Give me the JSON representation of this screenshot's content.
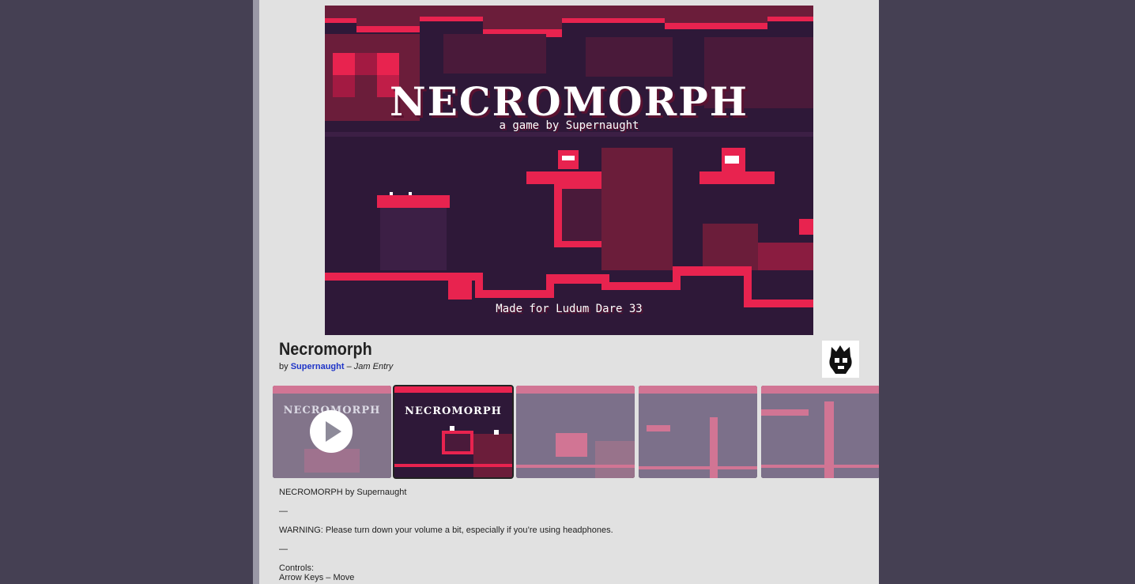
{
  "hero": {
    "title": "NECROMORPH",
    "subtitle": "a game by Supernaught",
    "footer": "Made for Ludum Dare 33"
  },
  "game": {
    "title": "Necromorph",
    "by_prefix": "by",
    "author": "Supernaught",
    "separator": "–",
    "entry_type": "Jam Entry"
  },
  "thumbnails": [
    {
      "kind": "video",
      "label": "NECROMORPH",
      "state": "dim"
    },
    {
      "kind": "image",
      "label": "NECROMORPH",
      "state": "active"
    },
    {
      "kind": "image",
      "label": "",
      "state": "dim"
    },
    {
      "kind": "image",
      "label": "",
      "state": "dim"
    },
    {
      "kind": "image",
      "label": "",
      "state": "dim"
    }
  ],
  "description": {
    "line1": "NECROMORPH by Supernaught",
    "rule1": "—",
    "warning": "WARNING: Please turn down your volume a bit, especially if you’re using headphones.",
    "rule2": "—",
    "controls_heading": "Controls:",
    "controls_line1": "Arrow Keys – Move"
  },
  "colors": {
    "background": "#454053",
    "panel": "#e1e1e1",
    "link": "#1f35c8",
    "game_crimson": "#e8234f",
    "game_dark": "#2a1533"
  },
  "icons": {
    "play": "play-icon",
    "avatar": "skull-avatar"
  }
}
